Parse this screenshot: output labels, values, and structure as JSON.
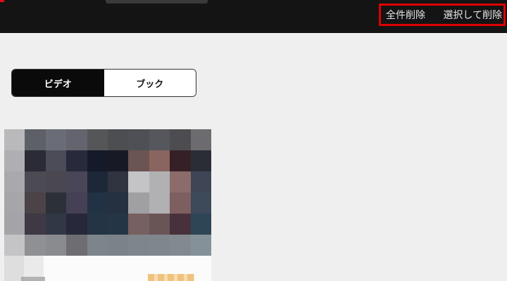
{
  "header": {
    "delete_all_label": "全件削除",
    "delete_selected_label": "選択して削除"
  },
  "tabs": [
    {
      "label": "ビデオ",
      "active": true
    },
    {
      "label": "ブック",
      "active": false
    }
  ],
  "colors": {
    "header_bg": "#141414",
    "page_bg": "#efefef",
    "highlight_box": "#e00000",
    "active_tab_bg": "#0a0a0a"
  }
}
